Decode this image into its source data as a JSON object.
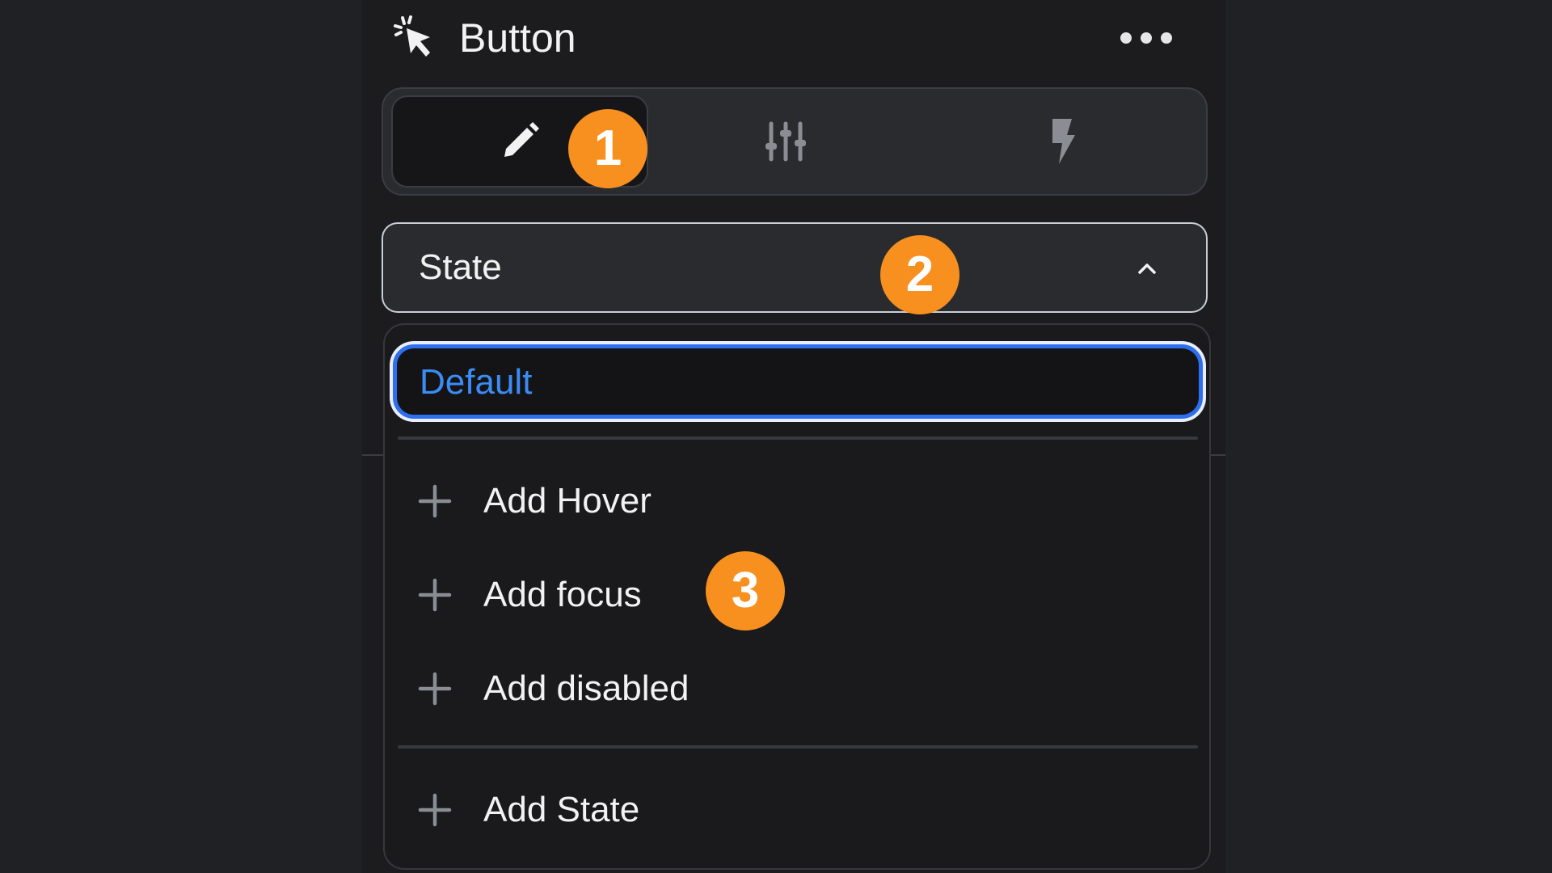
{
  "header": {
    "title": "Button",
    "icon": "cursor-click-icon",
    "more_icon": "more-horizontal-icon"
  },
  "tabs": [
    {
      "icon": "pencil-icon",
      "active": true
    },
    {
      "icon": "sliders-icon",
      "active": false
    },
    {
      "icon": "lightning-bolt-icon",
      "active": false
    }
  ],
  "state_select": {
    "label": "State",
    "expanded": true,
    "icon": "chevron-up-icon"
  },
  "dropdown": {
    "selected": "Default",
    "options": [
      "Add Hover",
      "Add focus",
      "Add disabled"
    ],
    "footer_option": "Add State",
    "option_icon": "plus-icon"
  },
  "badges": [
    "1",
    "2",
    "3"
  ],
  "colors": {
    "background": "#1f2124",
    "panel": "#1c1c1f",
    "accent_blue": "#3b8cf5",
    "badge_orange": "#f7901e",
    "text": "#f2f2f2"
  }
}
